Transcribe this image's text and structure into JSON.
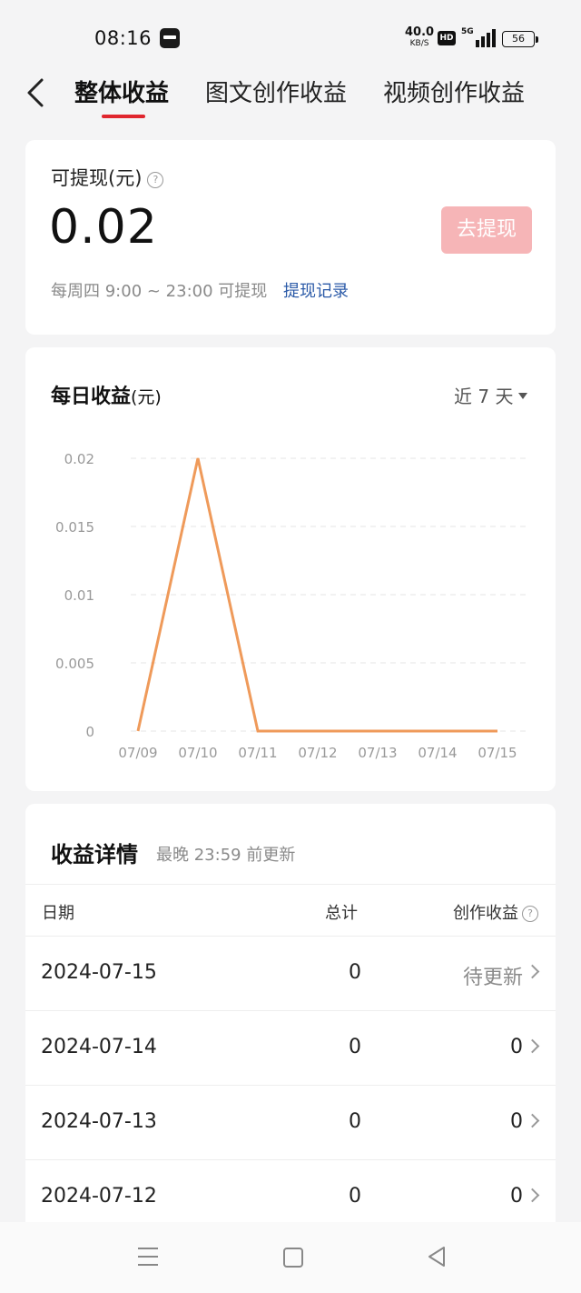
{
  "status_bar": {
    "time": "08:16",
    "net_speed": "40.0",
    "net_unit": "KB/S",
    "hd": "HD",
    "network": "5G",
    "battery": "56"
  },
  "nav": {
    "tabs": [
      {
        "label": "整体收益",
        "active": true
      },
      {
        "label": "图文创作收益",
        "active": false
      },
      {
        "label": "视频创作收益",
        "active": false
      }
    ],
    "accent": "#e0262e"
  },
  "withdraw": {
    "label": "可提现(元)",
    "help": "?",
    "amount": "0.02",
    "button_label": "去提现",
    "note": "每周四 9:00 ~ 23:00 可提现",
    "record_link": "提现记录"
  },
  "daily": {
    "title": "每日收益",
    "unit": "(元)",
    "range": "近 7 天"
  },
  "chart_data": {
    "type": "line",
    "title": "",
    "categories": [
      "07/09",
      "07/10",
      "07/11",
      "07/12",
      "07/13",
      "07/14",
      "07/15"
    ],
    "series": [
      {
        "values": [
          0,
          0.02,
          0,
          0,
          0,
          0,
          0
        ]
      }
    ],
    "ylim": [
      0,
      0.02
    ],
    "yticks": [
      0,
      0.005,
      0.01,
      0.015,
      0.02
    ],
    "ytick_labels": [
      "0",
      "0.005",
      "0.01",
      "0.015",
      "0.02"
    ],
    "grid": true,
    "line_color": "#ef9a5a"
  },
  "details": {
    "title": "收益详情",
    "subtitle": "最晚 23:59 前更新",
    "columns": {
      "date": "日期",
      "total": "总计",
      "creation": "创作收益"
    },
    "rows": [
      {
        "date": "2024-07-15",
        "total": "0",
        "creation": "待更新"
      },
      {
        "date": "2024-07-14",
        "total": "0",
        "creation": "0"
      },
      {
        "date": "2024-07-13",
        "total": "0",
        "creation": "0"
      },
      {
        "date": "2024-07-12",
        "total": "0",
        "creation": "0"
      }
    ]
  }
}
